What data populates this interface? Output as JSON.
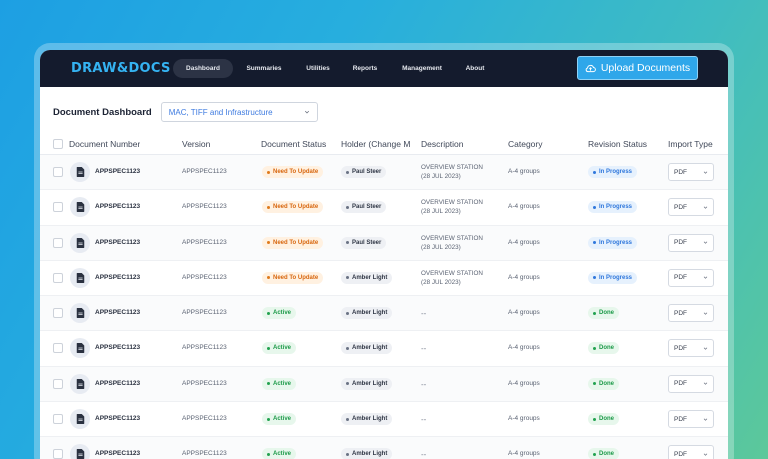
{
  "app": {
    "logo": "DRAW&DOCS",
    "nav": [
      {
        "label": "Dashboard",
        "active": true
      },
      {
        "label": "Summaries",
        "active": false
      },
      {
        "label": "Utilities",
        "active": false
      },
      {
        "label": "Reports",
        "active": false
      },
      {
        "label": "Management",
        "active": false
      },
      {
        "label": "About",
        "active": false
      }
    ],
    "upload_label": "Upload Documents",
    "upload_icon": "cloud-upload-icon"
  },
  "dashboard": {
    "title": "Document Dashboard",
    "filter_value": "MAC, TIFF and Infrastructure"
  },
  "table": {
    "columns": {
      "document_number": "Document Number",
      "version": "Version",
      "document_status": "Document Status",
      "holder": "Holder (Change M",
      "description": "Description",
      "category": "Category",
      "revision_status": "Revision Status",
      "import_type": "Import Type"
    },
    "rows": [
      {
        "doc": "APPSPEC1123",
        "version": "APPSPEC1123",
        "status": "Need To Update",
        "status_kind": "update",
        "holder": "Paul Steer",
        "desc1": "OVERVIEW STATION",
        "desc2": "(28 JUL 2023)",
        "category": "A-4 groups",
        "revision": "In Progress",
        "revision_kind": "progress",
        "import": "PDF"
      },
      {
        "doc": "APPSPEC1123",
        "version": "APPSPEC1123",
        "status": "Need To Update",
        "status_kind": "update",
        "holder": "Paul Steer",
        "desc1": "OVERVIEW STATION",
        "desc2": "(28 JUL 2023)",
        "category": "A-4 groups",
        "revision": "In Progress",
        "revision_kind": "progress",
        "import": "PDF"
      },
      {
        "doc": "APPSPEC1123",
        "version": "APPSPEC1123",
        "status": "Need To Update",
        "status_kind": "update",
        "holder": "Paul Steer",
        "desc1": "OVERVIEW STATION",
        "desc2": "(28 JUL 2023)",
        "category": "A-4 groups",
        "revision": "In Progress",
        "revision_kind": "progress",
        "import": "PDF"
      },
      {
        "doc": "APPSPEC1123",
        "version": "APPSPEC1123",
        "status": "Need To Update",
        "status_kind": "update",
        "holder": "Amber Light",
        "desc1": "OVERVIEW STATION",
        "desc2": "(28 JUL 2023)",
        "category": "A-4 groups",
        "revision": "In Progress",
        "revision_kind": "progress",
        "import": "PDF"
      },
      {
        "doc": "APPSPEC1123",
        "version": "APPSPEC1123",
        "status": "Active",
        "status_kind": "active",
        "holder": "Amber Light",
        "desc1": "--",
        "desc2": "",
        "category": "A-4 groups",
        "revision": "Done",
        "revision_kind": "done",
        "import": "PDF"
      },
      {
        "doc": "APPSPEC1123",
        "version": "APPSPEC1123",
        "status": "Active",
        "status_kind": "active",
        "holder": "Amber Light",
        "desc1": "--",
        "desc2": "",
        "category": "A-4 groups",
        "revision": "Done",
        "revision_kind": "done",
        "import": "PDF"
      },
      {
        "doc": "APPSPEC1123",
        "version": "APPSPEC1123",
        "status": "Active",
        "status_kind": "active",
        "holder": "Amber Light",
        "desc1": "--",
        "desc2": "",
        "category": "A-4 groups",
        "revision": "Done",
        "revision_kind": "done",
        "import": "PDF"
      },
      {
        "doc": "APPSPEC1123",
        "version": "APPSPEC1123",
        "status": "Active",
        "status_kind": "active",
        "holder": "Amber Light",
        "desc1": "--",
        "desc2": "",
        "category": "A-4 groups",
        "revision": "Done",
        "revision_kind": "done",
        "import": "PDF"
      },
      {
        "doc": "APPSPEC1123",
        "version": "APPSPEC1123",
        "status": "Active",
        "status_kind": "active",
        "holder": "Amber Light",
        "desc1": "--",
        "desc2": "",
        "category": "A-4 groups",
        "revision": "Done",
        "revision_kind": "done",
        "import": "PDF"
      }
    ]
  },
  "colors": {
    "brand": "#35b3f2",
    "topbar": "#141b2d",
    "upload_button": "#2fa7ea"
  }
}
